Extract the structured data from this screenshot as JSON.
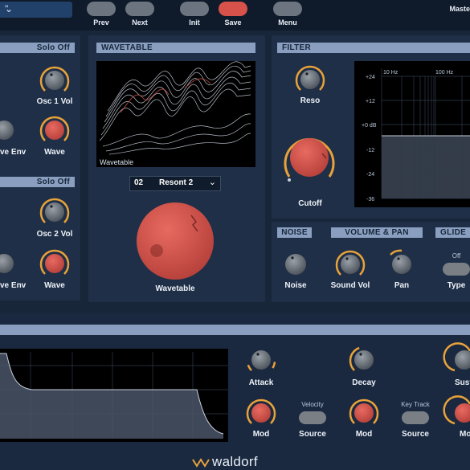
{
  "topbar": {
    "preset_name": "\"",
    "prev_label": "Prev",
    "next_label": "Next",
    "init_label": "Init",
    "save_label": "Save",
    "menu_label": "Menu",
    "master_label": "Maste"
  },
  "osc1": {
    "solo_label": "Solo Off",
    "vol_label": "Osc 1 Vol",
    "env_label": "ve Env",
    "wave_label": "Wave"
  },
  "osc2": {
    "solo_label": "Solo Off",
    "vol_label": "Osc 2 Vol",
    "env_label": "ve Env",
    "wave_label": "Wave"
  },
  "wavetable": {
    "header": "WAVETABLE",
    "display_caption": "Wavetable",
    "select_number": "02",
    "select_name": "Resont 2",
    "knob_label": "Wavetable"
  },
  "filter": {
    "header": "FILTER",
    "reso_label": "Reso",
    "cutoff_label": "Cutoff",
    "graph": {
      "x_ticks": [
        "10 Hz",
        "100 Hz"
      ],
      "y_ticks": [
        "+24",
        "+12",
        "+0 dB",
        "-12",
        "-24",
        "-36"
      ]
    }
  },
  "noise": {
    "header": "NOISE",
    "knob_label": "Noise"
  },
  "volume_pan": {
    "header": "VOLUME & PAN",
    "sound_vol_label": "Sound Vol",
    "pan_label": "Pan"
  },
  "glide": {
    "header": "GLIDE",
    "toggle_state": "Off",
    "type_label": "Type"
  },
  "envelope": {
    "attack_label": "Attack",
    "decay_label": "Decay",
    "sustain_label": "Susta",
    "mod1_label": "Mod",
    "velocity_label": "Velocity",
    "source1_label": "Source",
    "mod2_label": "Mod",
    "keytrack_label": "Key Track",
    "source2_label": "Source",
    "mod3_label": "Mo"
  },
  "brand": {
    "logo_text": "waldorf"
  },
  "colors": {
    "accent_orange": "#e8a23a",
    "knob_red": "#d9534b",
    "header_blue": "#8a9fc0",
    "panel": "#1f2f47"
  }
}
